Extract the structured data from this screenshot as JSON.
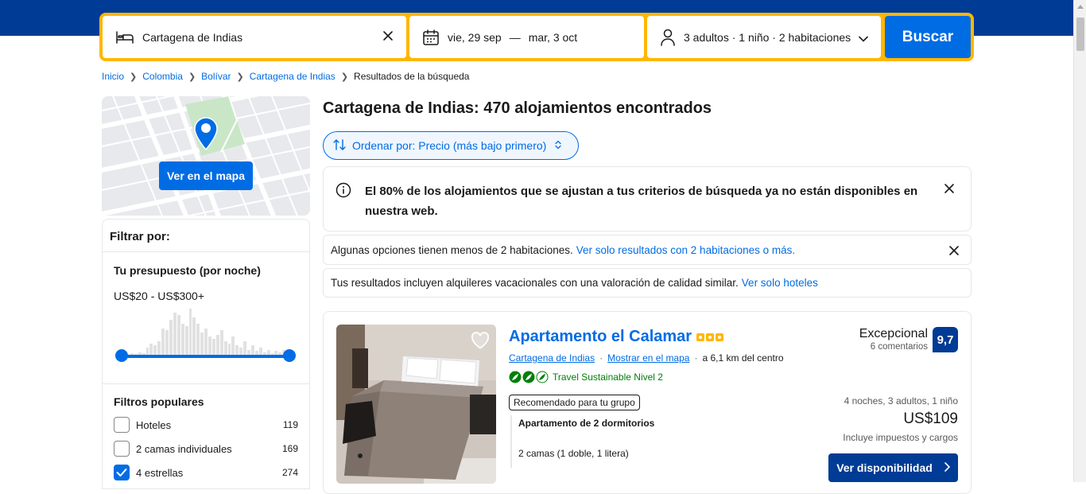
{
  "search": {
    "destination": "Cartagena de Indias",
    "date_start": "vie, 29 sep",
    "date_separator": "—",
    "date_end": "mar, 3 oct",
    "guests": "3 adultos · 1 niño · 2 habitaciones",
    "button_label": "Buscar"
  },
  "breadcrumb": {
    "items": [
      "Inicio",
      "Colombia",
      "Bolívar",
      "Cartagena de Indias"
    ],
    "current": "Resultados de la búsqueda"
  },
  "map": {
    "button_label": "Ver en el mapa"
  },
  "filters": {
    "title": "Filtrar por:",
    "budget_title": "Tu presupuesto (por noche)",
    "budget_range": "US$20 - US$300+",
    "budget_slider": {
      "min_fraction": 0.0,
      "max_fraction": 1.0
    },
    "histogram": [
      2,
      3,
      2,
      4,
      3,
      8,
      12,
      10,
      14,
      26,
      24,
      34,
      40,
      38,
      30,
      28,
      44,
      36,
      30,
      22,
      26,
      18,
      16,
      20,
      24,
      14,
      12,
      18,
      10,
      8,
      14,
      6,
      10,
      5,
      8,
      4,
      6,
      3,
      5,
      4,
      6
    ],
    "popular_title": "Filtros populares",
    "popular": [
      {
        "label": "Hoteles",
        "count": "119",
        "checked": false
      },
      {
        "label": "2 camas individuales",
        "count": "169",
        "checked": false
      },
      {
        "label": "4 estrellas",
        "count": "274",
        "checked": true
      }
    ]
  },
  "results": {
    "title": "Cartagena de Indias: 470 alojamientos encontrados",
    "sort_label": "Ordenar por: Precio (más bajo primero)",
    "notice": "El 80% de los alojamientos que se ajustan a tus criterios de búsqueda ya no están disponibles en nuestra web.",
    "msg1_text": "Algunas opciones tienen menos de 2 habitaciones.",
    "msg1_link": "Ver solo resultados con 2 habitaciones o más.",
    "msg2_text": "Tus resultados incluyen alquileres vacacionales con una valoración de calidad similar.",
    "msg2_link": "Ver solo hoteles"
  },
  "property": {
    "name": "Apartamento el Calamar",
    "stars": 3,
    "location_link": "Cartagena de Indias",
    "map_link": "Mostrar en el mapa",
    "distance": "a 6,1 km del centro",
    "sustainable": "Travel Sustainable Nivel 2",
    "tag": "Recomendado para tu grupo",
    "room_type": "Apartamento de 2 dormitorios",
    "beds": "2 camas (1 doble, 1 litera)",
    "score_word": "Excepcional",
    "score_reviews": "6 comentarios",
    "score": "9,7",
    "stay_details": "4 noches, 3 adultos, 1 niño",
    "price": "US$109",
    "taxes": "Incluye impuestos y cargos",
    "button_label": "Ver disponibilidad"
  },
  "colors": {
    "brand_dark": "#003b95",
    "brand_blue": "#006ce4",
    "search_border": "#ffb700",
    "green": "#008009"
  }
}
